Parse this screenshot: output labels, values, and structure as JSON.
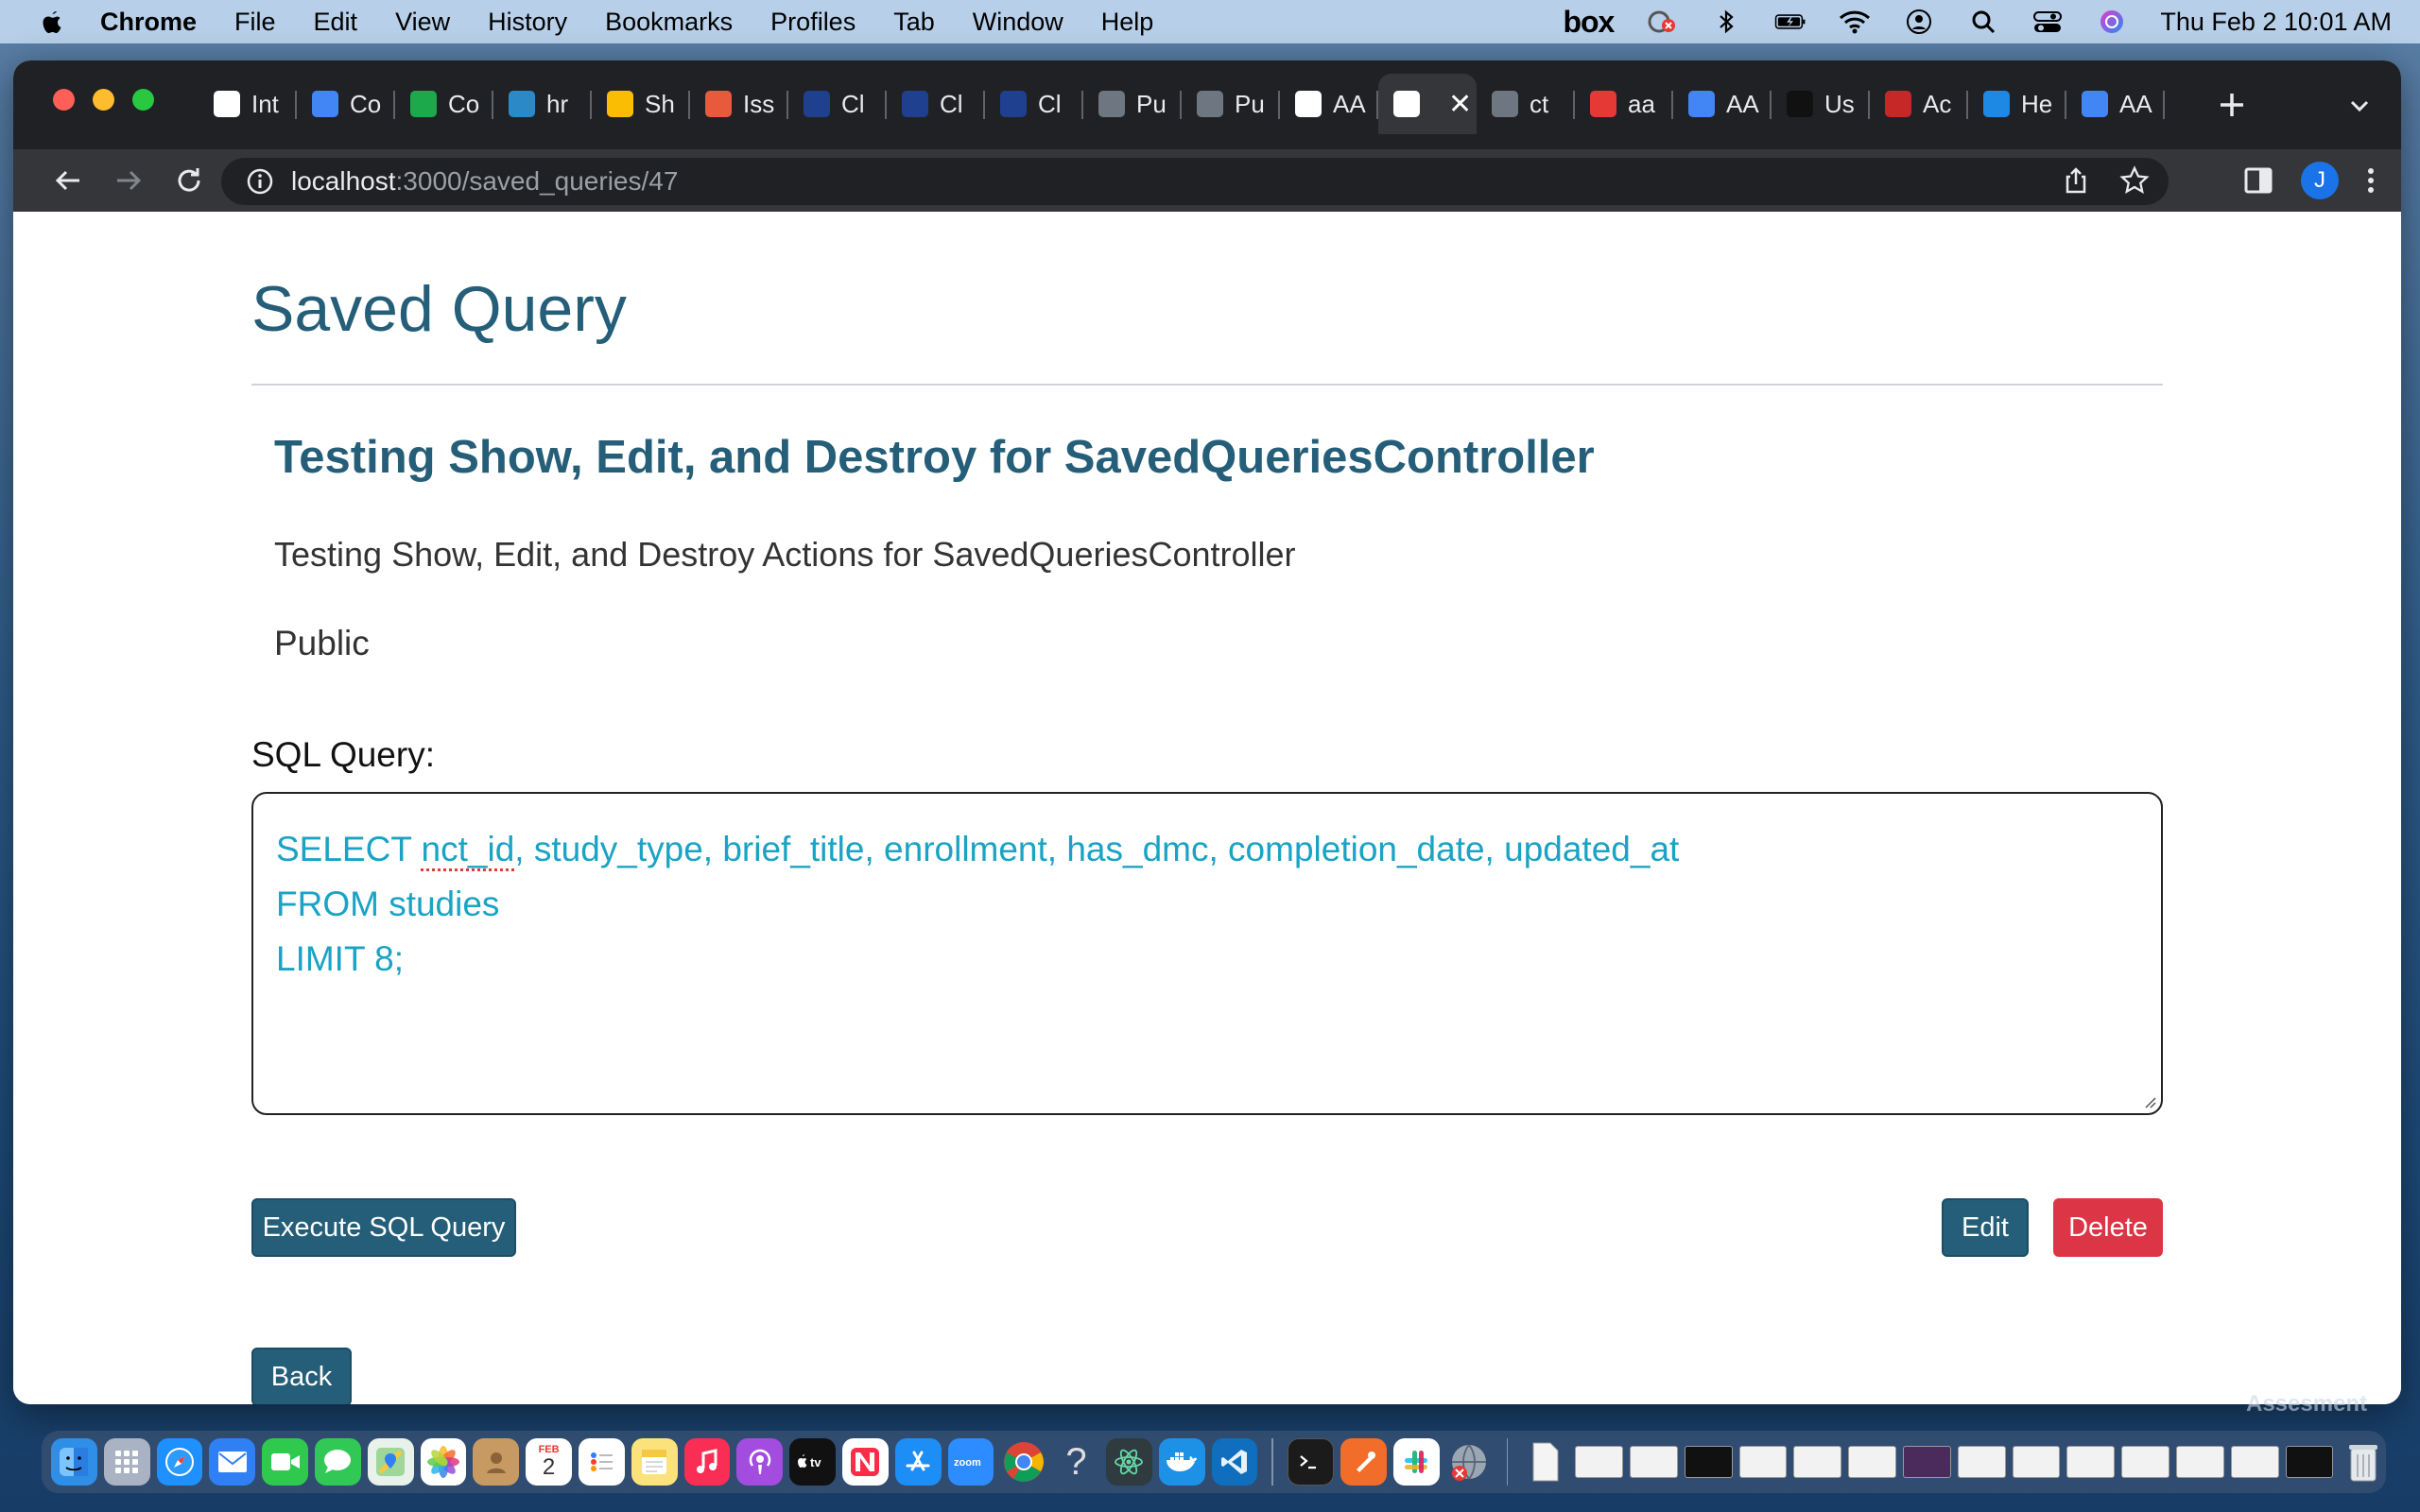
{
  "menubar": {
    "app_name": "Chrome",
    "menus": [
      "File",
      "Edit",
      "View",
      "History",
      "Bookmarks",
      "Profiles",
      "Tab",
      "Window",
      "Help"
    ],
    "box_label": "box",
    "clock": "Thu Feb 2  10:01 AM"
  },
  "browser": {
    "tabs": [
      {
        "label": "Int",
        "icon": "gmail-icon",
        "color": "#ffffff"
      },
      {
        "label": "Co",
        "icon": "calendar-icon",
        "color": "#4285f4"
      },
      {
        "label": "Co",
        "icon": "hackerrank-icon",
        "color": "#1ba94c"
      },
      {
        "label": "hr",
        "icon": "hr-icon",
        "color": "#2c89c8"
      },
      {
        "label": "Sh",
        "icon": "drive-icon",
        "color": "#fbbc04"
      },
      {
        "label": "Iss",
        "icon": "issue-icon",
        "color": "#e85a3b"
      },
      {
        "label": "Cl",
        "icon": "ct-icon",
        "color": "#1f3f8f"
      },
      {
        "label": "Cl",
        "icon": "ct-icon",
        "color": "#1f3f8f"
      },
      {
        "label": "Cl",
        "icon": "ct-icon",
        "color": "#1f3f8f"
      },
      {
        "label": "Pu",
        "icon": "github-icon",
        "color": "#6e7681"
      },
      {
        "label": "Pu",
        "icon": "github-icon",
        "color": "#6e7681"
      },
      {
        "label": "AA",
        "icon": "aact-icon",
        "color": "#ffffff"
      },
      {
        "label": "",
        "icon": "aact-icon",
        "color": "#ffffff",
        "active": true
      },
      {
        "label": "ct",
        "icon": "github-icon",
        "color": "#6e7681"
      },
      {
        "label": "aa",
        "icon": "app-icon",
        "color": "#e53935"
      },
      {
        "label": "AA",
        "icon": "docs-icon",
        "color": "#4285f4"
      },
      {
        "label": "Us",
        "icon": "k-icon",
        "color": "#111111"
      },
      {
        "label": "Ac",
        "icon": "ruby-icon",
        "color": "#c62828"
      },
      {
        "label": "He",
        "icon": "j-icon",
        "color": "#1e88e5"
      },
      {
        "label": "AA",
        "icon": "docs-icon",
        "color": "#4285f4"
      }
    ],
    "url_host": "localhost",
    "url_path": ":3000/saved_queries/47",
    "profile_initial": "J"
  },
  "page": {
    "title": "Saved Query",
    "query_name": "Testing Show, Edit, and Destroy for SavedQueriesController",
    "query_description": "Testing Show, Edit, and Destroy Actions for SavedQueriesController",
    "visibility": "Public",
    "sql_label": "SQL Query:",
    "sql_lines": {
      "line1_pre": "SELECT ",
      "line1_spell": "nct_id",
      "line1_post": ", study_type, brief_title, enrollment, has_dmc, completion_date, updated_at",
      "line2": "FROM studies",
      "line3": "LIMIT 8;"
    },
    "buttons": {
      "execute": "Execute SQL Query",
      "edit": "Edit",
      "delete": "Delete",
      "back": "Back"
    }
  },
  "desktop": {
    "label": "Assesment"
  },
  "dock": {
    "feb_label": "FEB",
    "feb_day": "2"
  }
}
